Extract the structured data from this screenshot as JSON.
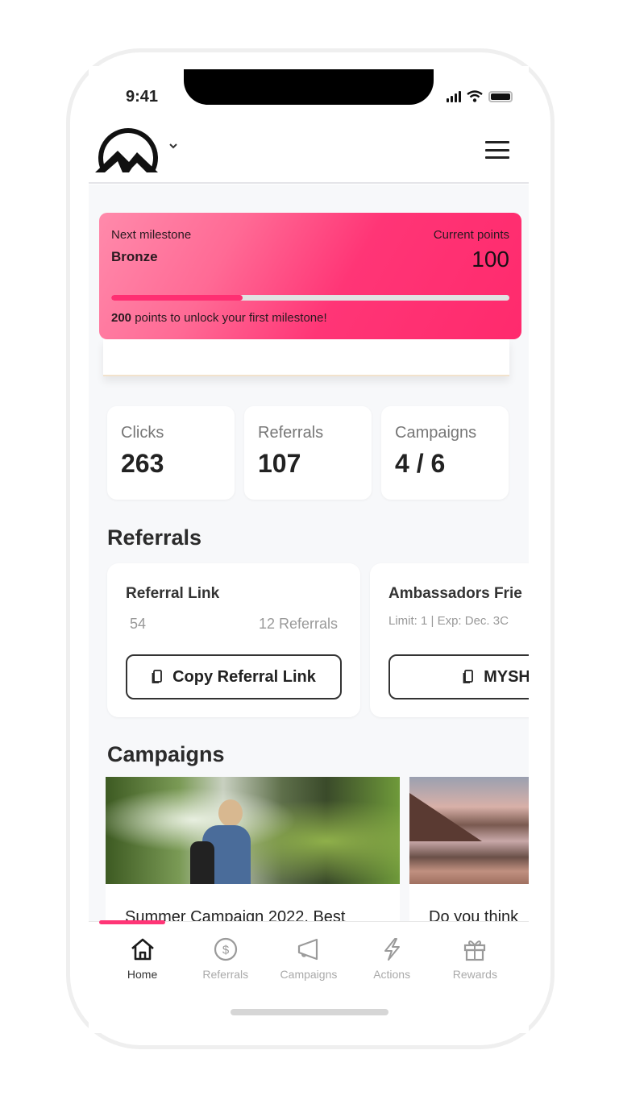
{
  "status_bar": {
    "time": "9:41"
  },
  "header": {
    "logo_alt": "mountain-logo",
    "menu_icon": "hamburger-icon"
  },
  "milestone": {
    "next_label": "Next milestone",
    "next_name": "Bronze",
    "current_label": "Current points",
    "current_value": "100",
    "progress_fraction": 0.33,
    "note_points": "200",
    "note_text": " points to unlock your first milestone!",
    "accent_color": "#ff2f72"
  },
  "stats": [
    {
      "label": "Clicks",
      "value": "263"
    },
    {
      "label": "Referrals",
      "value": "107"
    },
    {
      "label": "Campaigns",
      "value": "4 / 6"
    }
  ],
  "referrals": {
    "title": "Referrals",
    "cards": [
      {
        "title": "Referral Link",
        "left_meta": "54",
        "right_meta": "12 Referrals",
        "button_label": "Copy Referral Link"
      },
      {
        "title": "Ambassadors Frie",
        "meta": "Limit: 1 | Exp: Dec. 3C",
        "button_label": "MYSH"
      }
    ]
  },
  "campaigns": {
    "title": "Campaigns",
    "cards": [
      {
        "title": "Summer Campaign 2022. Best",
        "image": "hiker-in-forest-photo"
      },
      {
        "title": "Do you think",
        "image": "mountain-lake-sunset-photo"
      }
    ]
  },
  "bottom_nav": {
    "items": [
      {
        "label": "Home",
        "icon": "home-icon",
        "active": true
      },
      {
        "label": "Referrals",
        "icon": "dollar-circle-icon",
        "active": false
      },
      {
        "label": "Campaigns",
        "icon": "megaphone-icon",
        "active": false
      },
      {
        "label": "Actions",
        "icon": "lightning-icon",
        "active": false
      },
      {
        "label": "Rewards",
        "icon": "gift-icon",
        "active": false
      }
    ]
  }
}
